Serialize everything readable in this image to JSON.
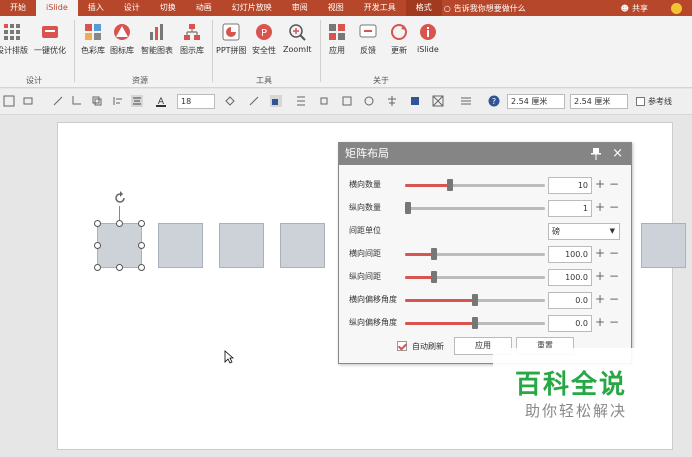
{
  "ribbon_tabs": [
    "开始",
    "iSlide",
    "插入",
    "设计",
    "切换",
    "动画",
    "幻灯片放映",
    "审阅",
    "视图",
    "开发工具",
    "格式"
  ],
  "tellme": "告诉我你想要做什么",
  "share": "共享",
  "ribbon": {
    "buttons": {
      "design_layout": "设计排版",
      "one_click": "一键优化",
      "color_lib": "色彩库",
      "icon_lib": "图标库",
      "smart_chart": "智能图表",
      "diagram_lib": "图示库",
      "ppt_puzzle": "PPT拼图",
      "security": "安全性",
      "zoomit": "ZoomIt",
      "apply": "应用",
      "feedback": "反馈",
      "update": "更新",
      "islide": "iSlide"
    },
    "groups": {
      "design": "设计",
      "resources": "资源",
      "tools": "工具",
      "about": "关于"
    }
  },
  "toolbar2": {
    "font_size": "18",
    "height": "2.54 厘米",
    "width": "2.54 厘米",
    "ref_line": "参考线"
  },
  "dialog": {
    "title": "矩阵布局",
    "rows": [
      {
        "label": "横向数量",
        "value": "10",
        "level": 0.32
      },
      {
        "label": "纵向数量",
        "value": "1",
        "level": 0.02
      },
      {
        "label": "间距单位",
        "select": "磅"
      },
      {
        "label": "横向间距",
        "value": "100.0",
        "level": 0.21
      },
      {
        "label": "纵向间距",
        "value": "100.0",
        "level": 0.21
      },
      {
        "label": "横向偏移角度",
        "value": "0.0",
        "level": 0.5
      },
      {
        "label": "纵向偏移角度",
        "value": "0.0",
        "level": 0.5
      }
    ],
    "auto_refresh": "自动刷新",
    "apply": "应用",
    "reset": "重置"
  },
  "watermark": {
    "main": "百科全说",
    "sub": "助你轻松解决"
  },
  "colors": {
    "brand": "#b7472a",
    "accent": "#d9534f",
    "shape_fill": "#cdd2d8",
    "watermark": "#28a745"
  }
}
